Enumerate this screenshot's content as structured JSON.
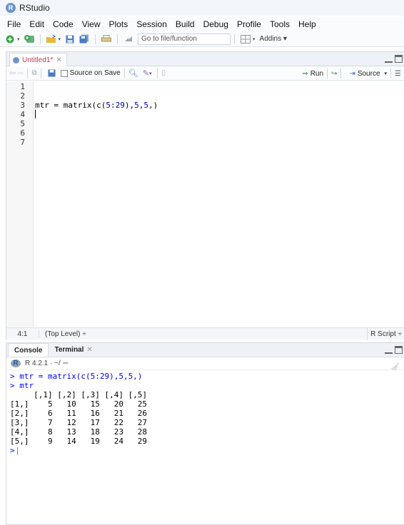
{
  "window": {
    "title": "RStudio",
    "logo_letter": "R"
  },
  "menu": [
    "File",
    "Edit",
    "Code",
    "View",
    "Plots",
    "Session",
    "Build",
    "Debug",
    "Profile",
    "Tools",
    "Help"
  ],
  "toolbar": {
    "goto_placeholder": "Go to file/function",
    "addins_label": "Addins"
  },
  "editor": {
    "tab_label": "Untitled1*",
    "source_on_save_label": "Source on Save",
    "run_label": "Run",
    "source_label": "Source",
    "lines": [
      "1",
      "2",
      "3",
      "4",
      "5",
      "6",
      "7"
    ],
    "code_line3_prefix": "mtr = matrix(c(",
    "code_line3_num1": "5",
    "code_line3_colon": ":",
    "code_line3_num2": "29",
    "code_line3_mid": "),",
    "code_line3_num3": "5",
    "code_line3_comma": ",",
    "code_line3_num4": "5",
    "code_line3_suffix": ",)",
    "status_position": "4:1",
    "status_scope": "(Top Level) ÷",
    "status_lang": "R Script ÷"
  },
  "console": {
    "tabs": [
      "Console",
      "Terminal"
    ],
    "r_version": "R 4.2.1 · ~/",
    "lines": [
      "> mtr = matrix(c(5:29),5,5,)",
      "> mtr"
    ],
    "output": [
      "     [,1] [,2] [,3] [,4] [,5]",
      "[1,]    5   10   15   20   25",
      "[2,]    6   11   16   21   26",
      "[3,]    7   12   17   22   27",
      "[4,]    8   13   18   23   28",
      "[5,]    9   14   19   24   29"
    ],
    "prompt": ">"
  },
  "colors": {
    "accent": "#6d95c8",
    "tab_modified": "#c6354f",
    "console_input": "#0000ff",
    "number": "#0000cc"
  }
}
